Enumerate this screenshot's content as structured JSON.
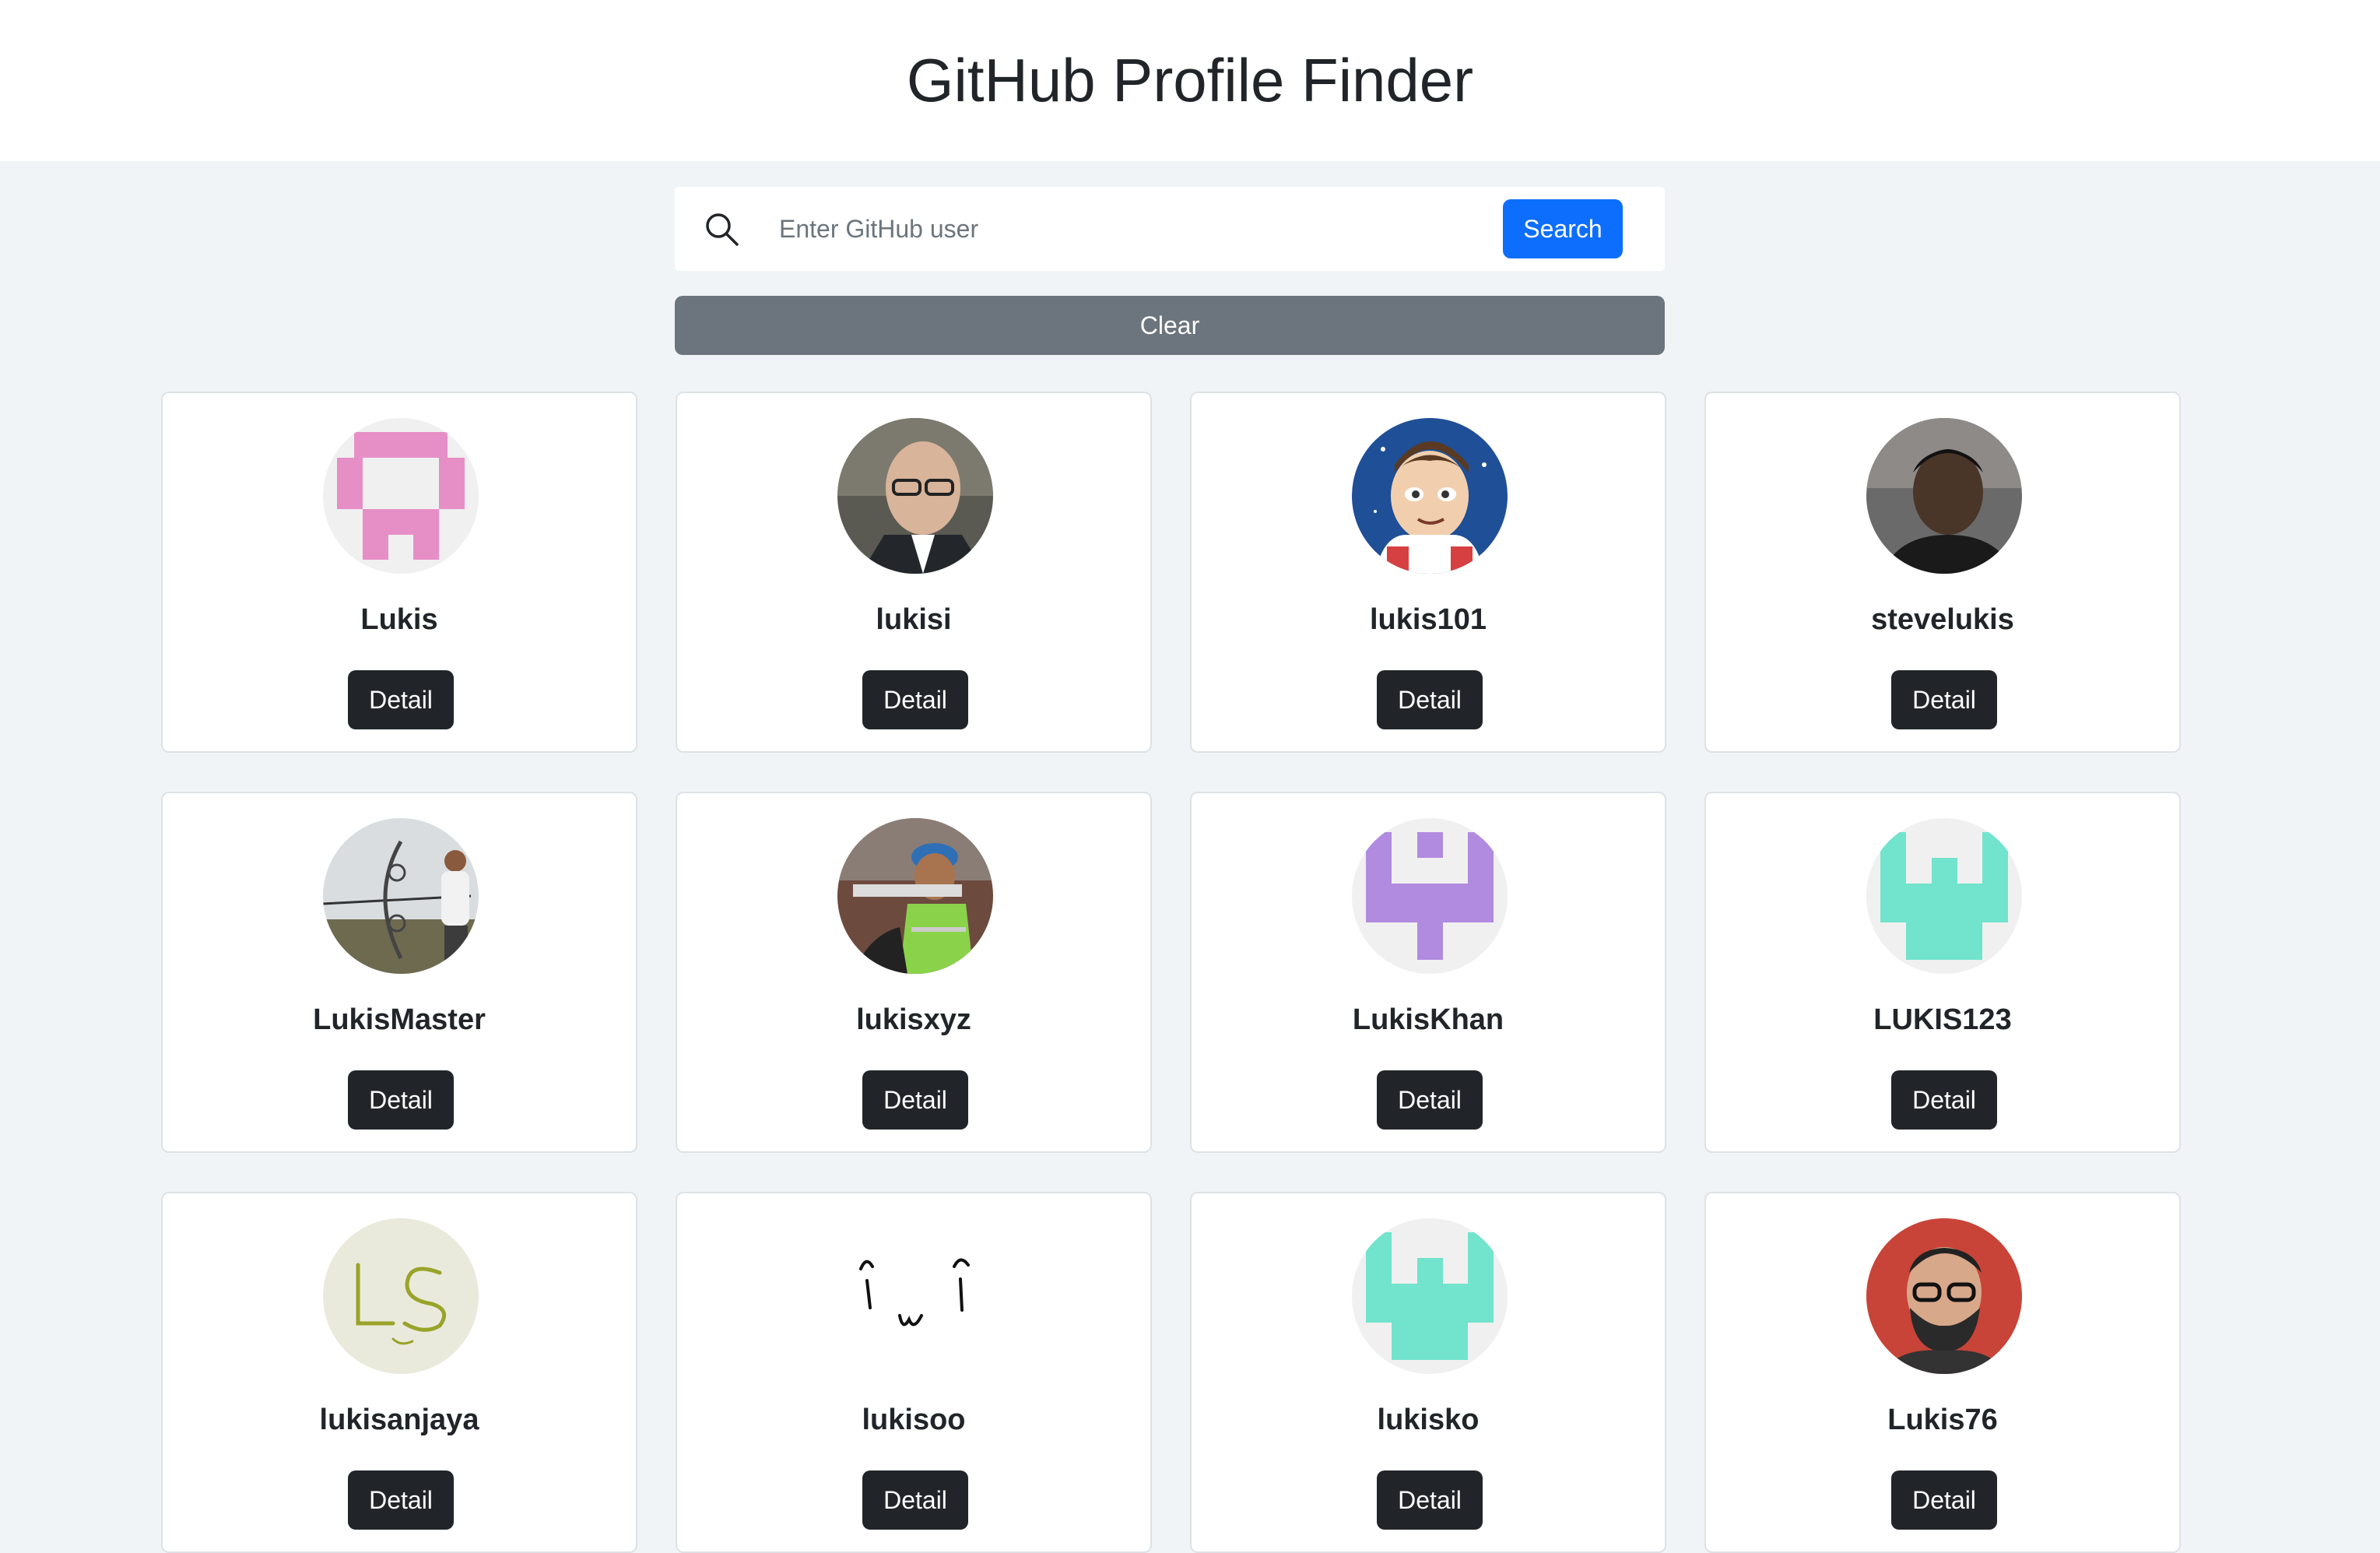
{
  "header": {
    "title": "GitHub Profile Finder"
  },
  "search": {
    "icon": "search-icon",
    "placeholder": "Enter GitHub user",
    "value": "",
    "button_label": "Search"
  },
  "clear": {
    "label": "Clear"
  },
  "colors": {
    "primary": "#0d6efd",
    "secondary": "#6c757d",
    "dark": "#212529",
    "background": "#f1f4f7"
  },
  "users": [
    {
      "login": "Lukis",
      "detail_label": "Detail",
      "avatar": "identicon-pink"
    },
    {
      "login": "lukisi",
      "detail_label": "Detail",
      "avatar": "photo-man-glasses"
    },
    {
      "login": "lukis101",
      "detail_label": "Detail",
      "avatar": "cartoon-astronaut"
    },
    {
      "login": "stevelukis",
      "detail_label": "Detail",
      "avatar": "photo-man-dark"
    },
    {
      "login": "LukisMaster",
      "detail_label": "Detail",
      "avatar": "photo-archer"
    },
    {
      "login": "lukisxyz",
      "detail_label": "Detail",
      "avatar": "photo-worker-helmet"
    },
    {
      "login": "LukisKhan",
      "detail_label": "Detail",
      "avatar": "identicon-purple"
    },
    {
      "login": "LUKIS123",
      "detail_label": "Detail",
      "avatar": "identicon-teal"
    },
    {
      "login": "lukisanjaya",
      "detail_label": "Detail",
      "avatar": "handwritten-ls"
    },
    {
      "login": "lukisoo",
      "detail_label": "Detail",
      "avatar": "doodle-face"
    },
    {
      "login": "lukisko",
      "detail_label": "Detail",
      "avatar": "identicon-teal"
    },
    {
      "login": "Lukis76",
      "detail_label": "Detail",
      "avatar": "photo-man-beard"
    }
  ]
}
